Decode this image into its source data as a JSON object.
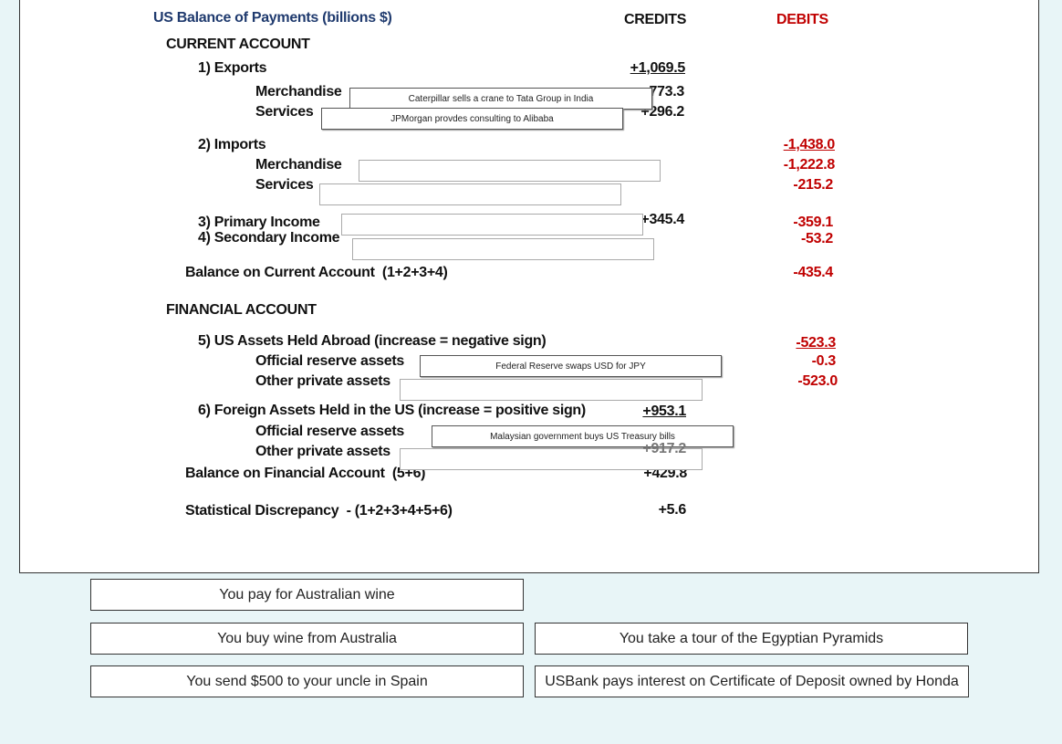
{
  "title": "US Balance of Payments (billions $)",
  "credits_header": "CREDITS",
  "debits_header": "DEBITS",
  "current_account": "CURRENT ACCOUNT",
  "exports": {
    "label": "1) Exports",
    "credit": "+1,069.5",
    "merch_label": "Merchandise",
    "merch_credit": "+773.3",
    "serv_label": "Services",
    "serv_credit": "+296.2"
  },
  "imports": {
    "label": "2) Imports",
    "debit": "-1,438.0",
    "merch_label": "Merchandise",
    "merch_debit": "-1,222.8",
    "serv_label": "Services",
    "serv_debit": "-215.2"
  },
  "primary": {
    "label": "3) Primary Income",
    "credit": "+345.4",
    "debit": "-359.1"
  },
  "secondary": {
    "label": "4) Secondary Income",
    "debit": "-53.2"
  },
  "bca": {
    "label": "Balance on Current Account  (1+2+3+4)",
    "debit": "-435.4"
  },
  "financial_account": "FINANCIAL ACCOUNT",
  "us_assets": {
    "label": "5) US Assets Held Abroad (increase = negative sign)",
    "debit": "-523.3",
    "official_label": "Official reserve assets",
    "official_debit": "-0.3",
    "private_label": "Other private assets",
    "private_debit": "-523.0"
  },
  "foreign_assets": {
    "label": "6) Foreign Assets Held in the US (increase = positive sign)",
    "credit": "+953.1",
    "official_label": "Official reserve assets",
    "private_label": "Other private assets",
    "private_credit": "+917.2"
  },
  "bfa": {
    "label": "Balance on Financial Account  (5+6)",
    "credit": "+429.8"
  },
  "discrepancy": {
    "label": "Statistical Discrepancy  - (1+2+3+4+5+6)",
    "credit": "+5.6"
  },
  "drops": [
    "Caterpillar sells a crane to Tata Group in India",
    "JPMorgan provdes consulting to Alibaba",
    "",
    "",
    "",
    "",
    "Federal Reserve swaps USD for JPY",
    "",
    "Malaysian government buys US Treasury bills",
    ""
  ],
  "cards": [
    "You pay for Australian wine",
    "You buy wine from Australia",
    "You take a tour of the Egyptian Pyramids",
    "You send $500 to your uncle in Spain",
    "USBank pays interest on Certificate of Deposit owned by Honda"
  ]
}
